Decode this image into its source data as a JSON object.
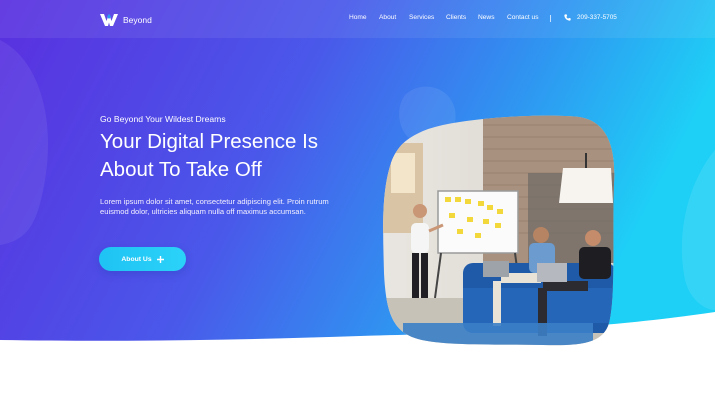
{
  "brand": {
    "name": "Beyond"
  },
  "nav": {
    "items": [
      {
        "label": "Home"
      },
      {
        "label": "About"
      },
      {
        "label": "Services"
      },
      {
        "label": "Clients"
      },
      {
        "label": "News"
      },
      {
        "label": "Contact us"
      }
    ],
    "phone": "209-337-5705",
    "phone_icon": "phone-icon"
  },
  "hero": {
    "eyebrow": "Go Beyond Your Wildest Dreams",
    "title_line1": "Your Digital Presence Is",
    "title_line2": "About To Take Off",
    "lead": "Lorem ipsum dolor sit amet, consectetur adipiscing elit. Proin rutrum euismod dolor, ultricies aliquam nulla off maximus accumsan.",
    "cta_label": "About Us",
    "cta_icon": "plus-icon"
  },
  "colors": {
    "gradient_start": "#5b2fe0",
    "gradient_end": "#1ecdf6",
    "cta": "#22c6f5"
  }
}
